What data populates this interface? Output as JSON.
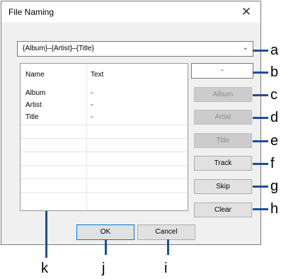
{
  "dialog": {
    "title": "File Naming",
    "close_glyph": "✕",
    "pattern_value": "{Album}–{Artist}–{Title}",
    "dropdown_glyph": "⌄"
  },
  "list": {
    "columns": [
      "Name",
      "Text"
    ],
    "rows": [
      {
        "name": "Album",
        "text": "-"
      },
      {
        "name": "Artist",
        "text": "-"
      },
      {
        "name": "Title",
        "text": "-"
      }
    ]
  },
  "buttons": {
    "separator_value": "-",
    "album": "Album",
    "artist": "Artist",
    "title": "Title",
    "track": "Track",
    "skip": "Skip",
    "clear": "Clear",
    "ok": "OK",
    "cancel": "Cancel"
  },
  "callouts": [
    "a",
    "b",
    "c",
    "d",
    "e",
    "f",
    "g",
    "h",
    "i",
    "j",
    "k"
  ],
  "colors": {
    "callout_line": "#1f4f99"
  }
}
